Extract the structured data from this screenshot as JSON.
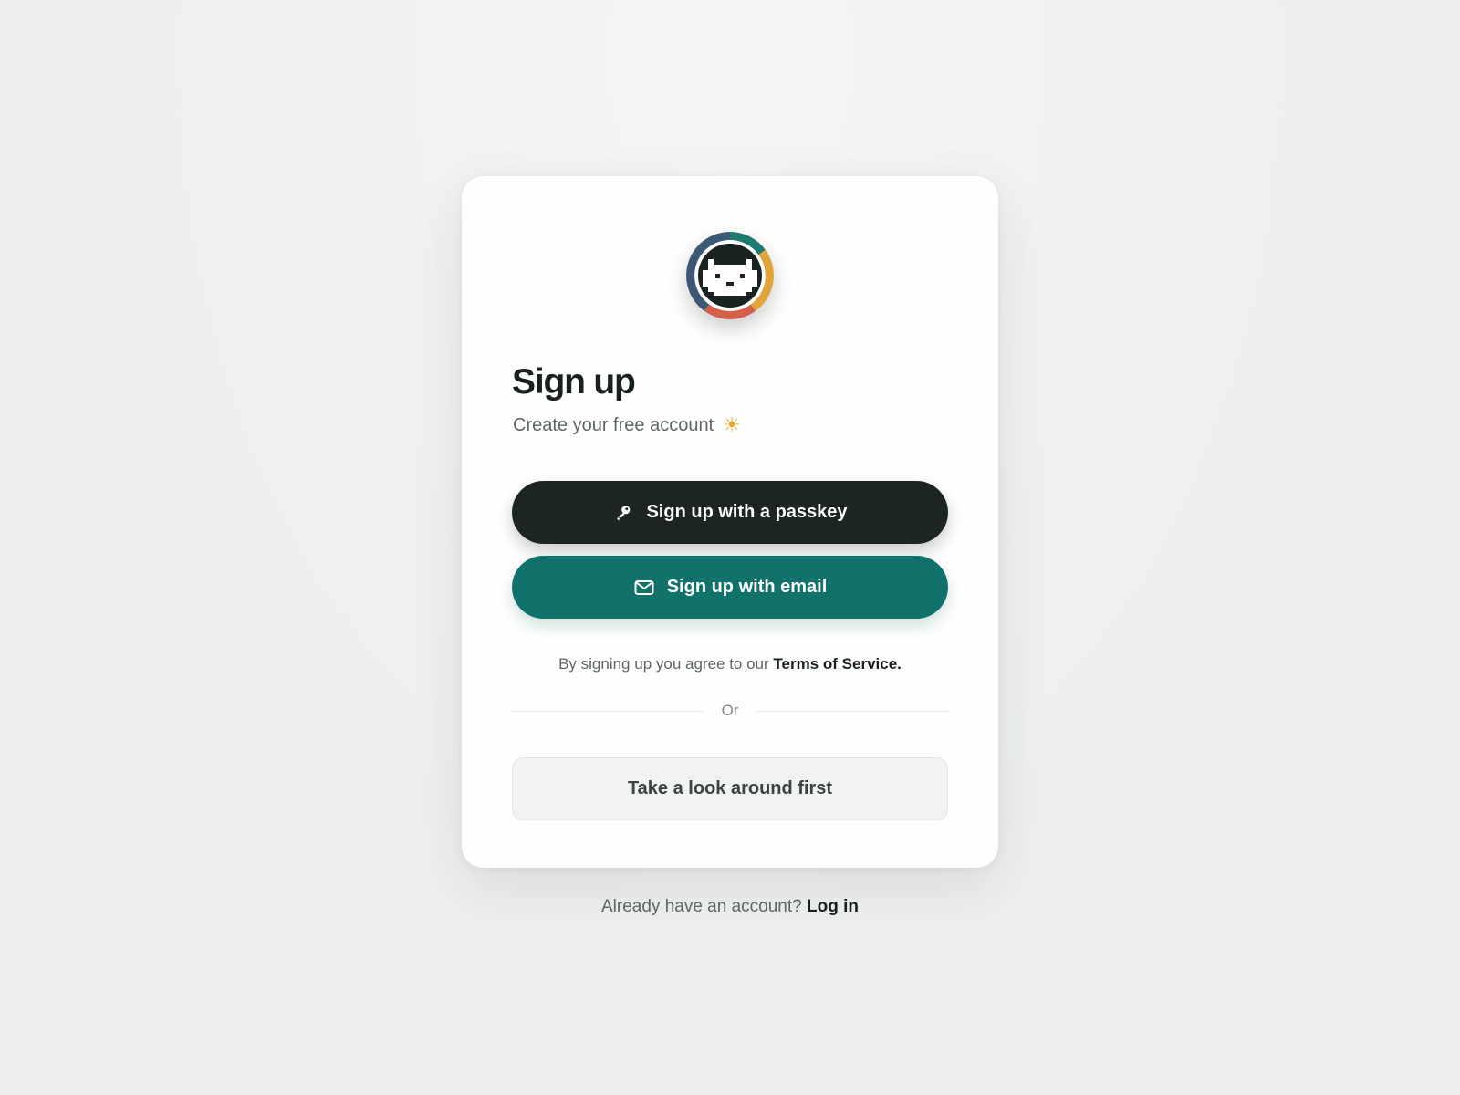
{
  "header": {
    "avatar_icon": "pixel-cat-avatar-icon",
    "title": "Sign up",
    "subtitle": "Create your free account",
    "subtitle_icon": "sun-icon"
  },
  "actions": {
    "passkey_label": "Sign up with a passkey",
    "passkey_icon": "key-icon",
    "email_label": "Sign up with email",
    "email_icon": "mail-icon",
    "browse_label": "Take a look around first"
  },
  "terms": {
    "prefix": "By signing up you agree to our",
    "link": "Terms of Service."
  },
  "divider": {
    "label": "Or"
  },
  "footer": {
    "prompt": "Already have an account?",
    "login_link": "Log in"
  },
  "colors": {
    "primary_dark": "#1c2523",
    "accent_teal": "#11716b",
    "sun": "#e6a826",
    "ring_teal": "#1d7a70",
    "ring_gold": "#e0a43a",
    "ring_red": "#d5604a",
    "ring_slate": "#3b5874"
  }
}
